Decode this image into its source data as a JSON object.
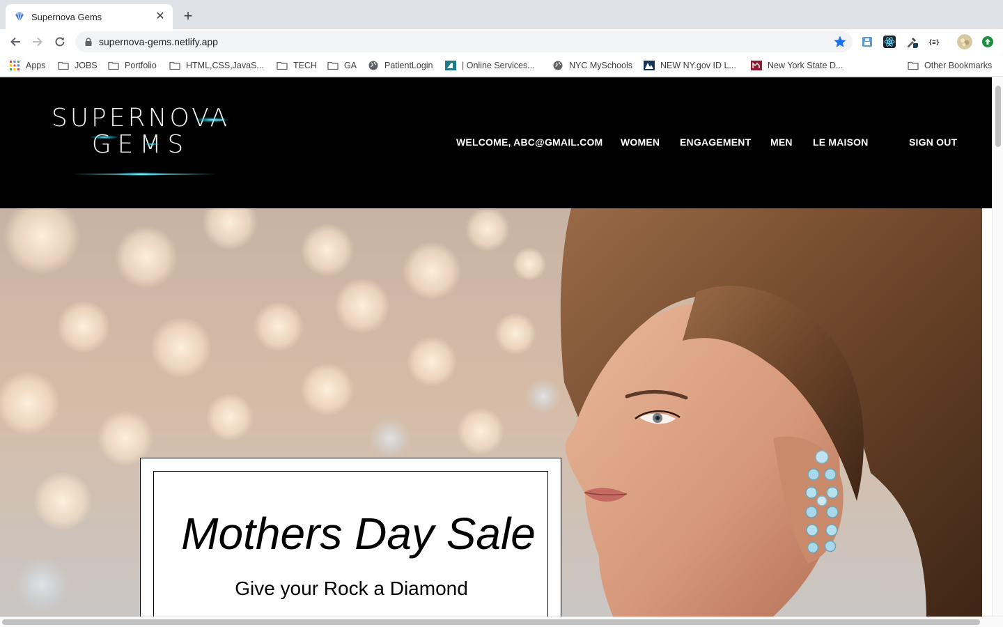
{
  "browser": {
    "tab_title": "Supernova Gems",
    "close_glyph": "✕",
    "newtab_glyph": "+",
    "url": "supernova-gems.netlify.app",
    "bookmarks": [
      {
        "label": "Apps",
        "icon": "apps-grid-icon"
      },
      {
        "label": "JOBS",
        "icon": "folder-icon"
      },
      {
        "label": "Portfolio",
        "icon": "folder-icon"
      },
      {
        "label": "HTML,CSS,JavaS...",
        "icon": "folder-icon"
      },
      {
        "label": "TECH",
        "icon": "folder-icon"
      },
      {
        "label": "GA",
        "icon": "folder-icon"
      },
      {
        "label": "PatientLogin",
        "icon": "globe-icon"
      },
      {
        "label": "| Online Services...",
        "icon": "site-favicon"
      },
      {
        "label": "NYC MySchools",
        "icon": "globe-icon"
      },
      {
        "label": "NEW NY.gov ID L...",
        "icon": "site-favicon"
      },
      {
        "label": "New York State D...",
        "icon": "site-favicon"
      },
      {
        "label": "Other Bookmarks",
        "icon": "folder-icon"
      }
    ]
  },
  "site": {
    "logo_line1": "SUPERNOVA",
    "logo_line2": "GEMS",
    "nav": {
      "welcome": "WELCOME, ABC@GMAIL.COM",
      "women": "WOMEN",
      "engagement": "ENGAGEMENT",
      "men": "MEN",
      "le_maison": "LE MAISON",
      "sign_out": "SIGN OUT"
    },
    "promo": {
      "title": "Mothers Day Sale",
      "subtitle": "Give your Rock a Diamond"
    }
  },
  "colors": {
    "header_bg": "#000000",
    "accent_glow": "#29d3e6",
    "star_blue": "#1a73e8"
  }
}
